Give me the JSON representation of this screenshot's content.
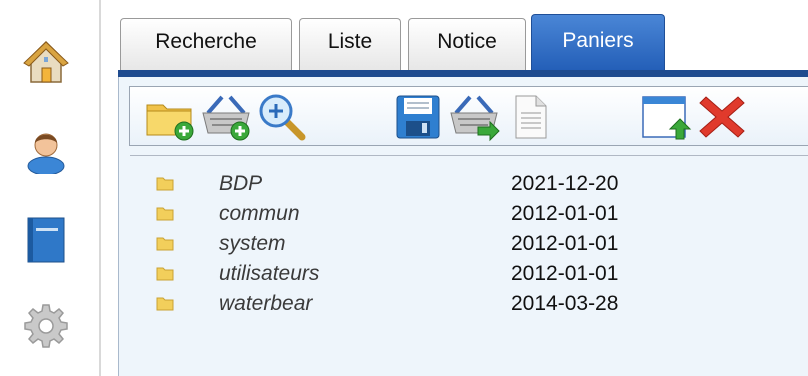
{
  "sidebar": {
    "items": [
      {
        "icon": "home-icon"
      },
      {
        "icon": "user-icon"
      },
      {
        "icon": "book-icon"
      },
      {
        "icon": "gear-icon"
      }
    ]
  },
  "tabs": [
    {
      "label": "Recherche",
      "active": false
    },
    {
      "label": "Liste",
      "active": false
    },
    {
      "label": "Notice",
      "active": false
    },
    {
      "label": "Paniers",
      "active": true
    }
  ],
  "toolbar": {
    "buttons": [
      {
        "icon": "new-folder-icon"
      },
      {
        "icon": "add-basket-icon"
      },
      {
        "icon": "search-icon"
      },
      {
        "icon": "save-icon"
      },
      {
        "icon": "basket-export-icon"
      },
      {
        "icon": "document-icon"
      },
      {
        "icon": "upload-window-icon"
      },
      {
        "icon": "delete-icon"
      }
    ]
  },
  "baskets": [
    {
      "name": "BDP",
      "date": "2021-12-20"
    },
    {
      "name": "commun",
      "date": "2012-01-01"
    },
    {
      "name": "system",
      "date": "2012-01-01"
    },
    {
      "name": "utilisateurs",
      "date": "2012-01-01"
    },
    {
      "name": "waterbear",
      "date": "2014-03-28"
    }
  ],
  "colors": {
    "active_tab": "#2f6cc4",
    "tab_underline": "#1f4b8f",
    "panel_bg": "#eef5fb",
    "folder": "#f2cf5b",
    "delete": "#e03a2c"
  }
}
